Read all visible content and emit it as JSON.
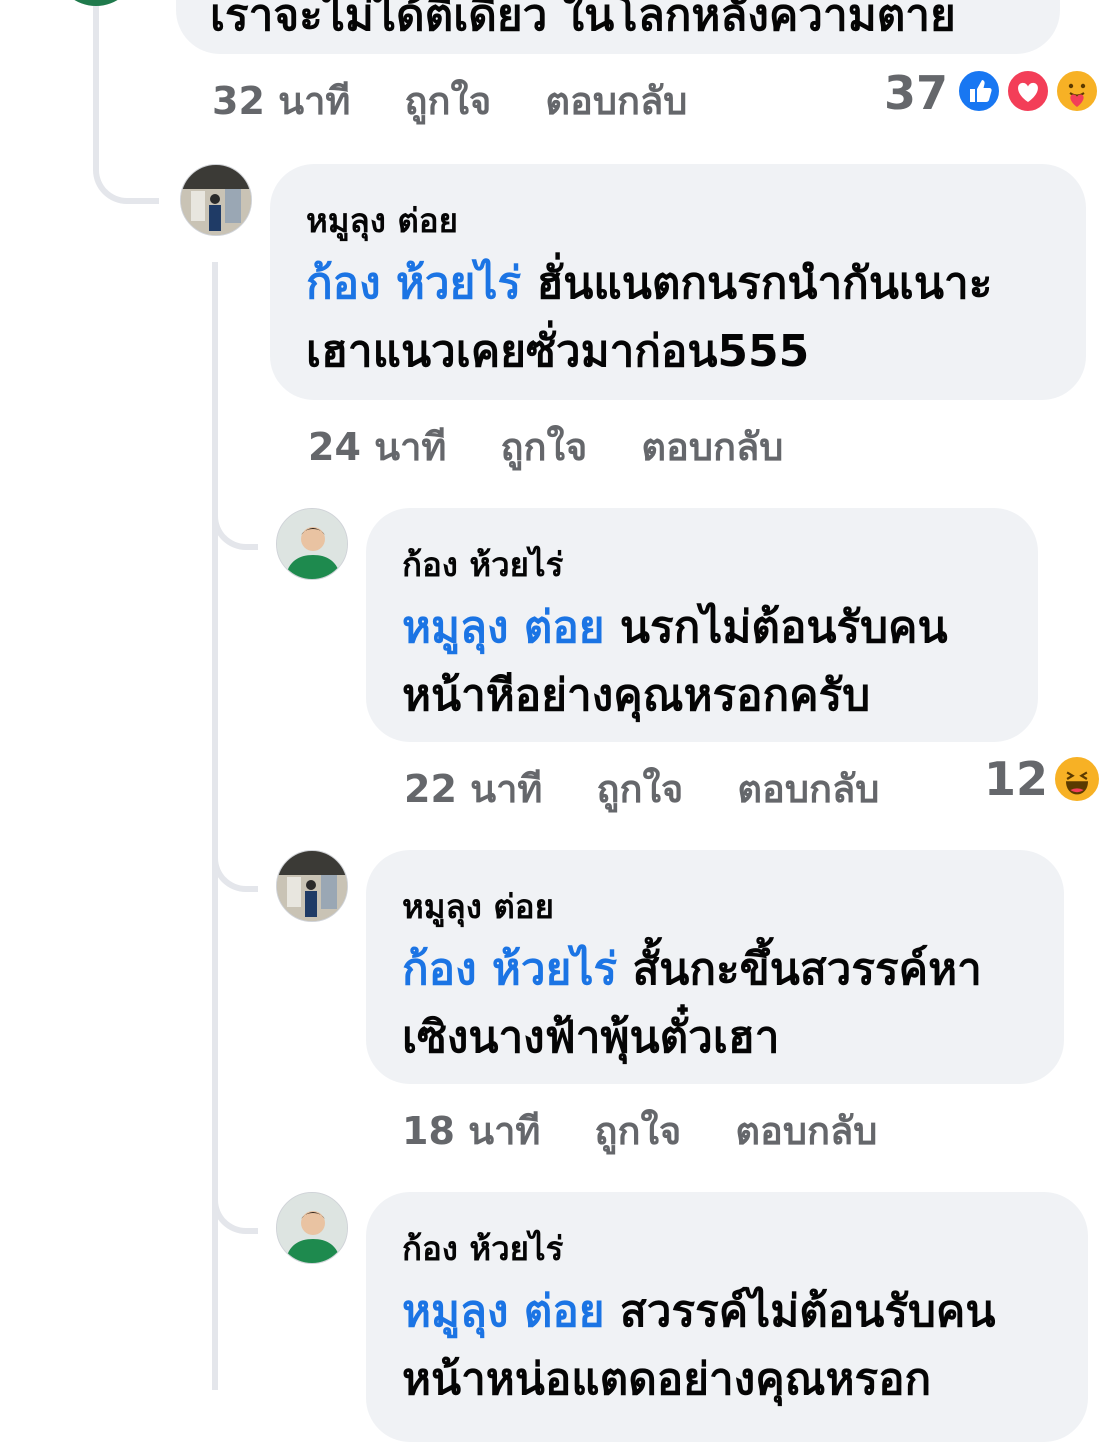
{
  "top_comment": {
    "text_partial": "เราจะไม่ได้ตีเดียว ในโลกหลังความตาย",
    "time": "32 นาที",
    "like": "ถูกใจ",
    "reply": "ตอบกลับ",
    "reaction_count": "37",
    "reactions": [
      "like-icon",
      "love-icon",
      "care-icon"
    ]
  },
  "replies": [
    {
      "author": "หมูลุง ต่อย",
      "mention": "ก้อง ห้วยไร่",
      "line1": "ฮั่นแนตกนรกนำกันเนาะ",
      "line2": "เฮาแนวเคยซั่วมาก่อน555",
      "time": "24 นาที",
      "like": "ถูกใจ",
      "reply": "ตอบกลับ"
    },
    {
      "author": "ก้อง ห้วยไร่",
      "mention": "หมูลุง ต่อย",
      "line1": "นรกไม่ต้อนรับคน",
      "line2": "หน้าหีอย่างคุณหรอกครับ",
      "time": "22 นาที",
      "like": "ถูกใจ",
      "reply": "ตอบกลับ",
      "reaction_count": "12",
      "reactions": [
        "haha-icon"
      ]
    },
    {
      "author": "หมูลุง ต่อย",
      "mention": "ก้อง ห้วยไร่",
      "line1": "สั้นกะขึ้นสวรรค์หา",
      "line2": "เซิงนางฟ้าพุ้นตั๋วเฮา",
      "time": "18 นาที",
      "like": "ถูกใจ",
      "reply": "ตอบกลับ"
    },
    {
      "author": "ก้อง ห้วยไร่",
      "mention": "หมูลุง ต่อย",
      "line1": "สวรรค์ไม่ต้อนรับคน",
      "line2": "หน้าหน่อแตดอย่างคุณหรอก"
    }
  ],
  "colors": {
    "bubble": "#f0f2f5",
    "mention": "#1b74e4",
    "meta": "#65676b",
    "thread_line": "#e4e6eb"
  }
}
